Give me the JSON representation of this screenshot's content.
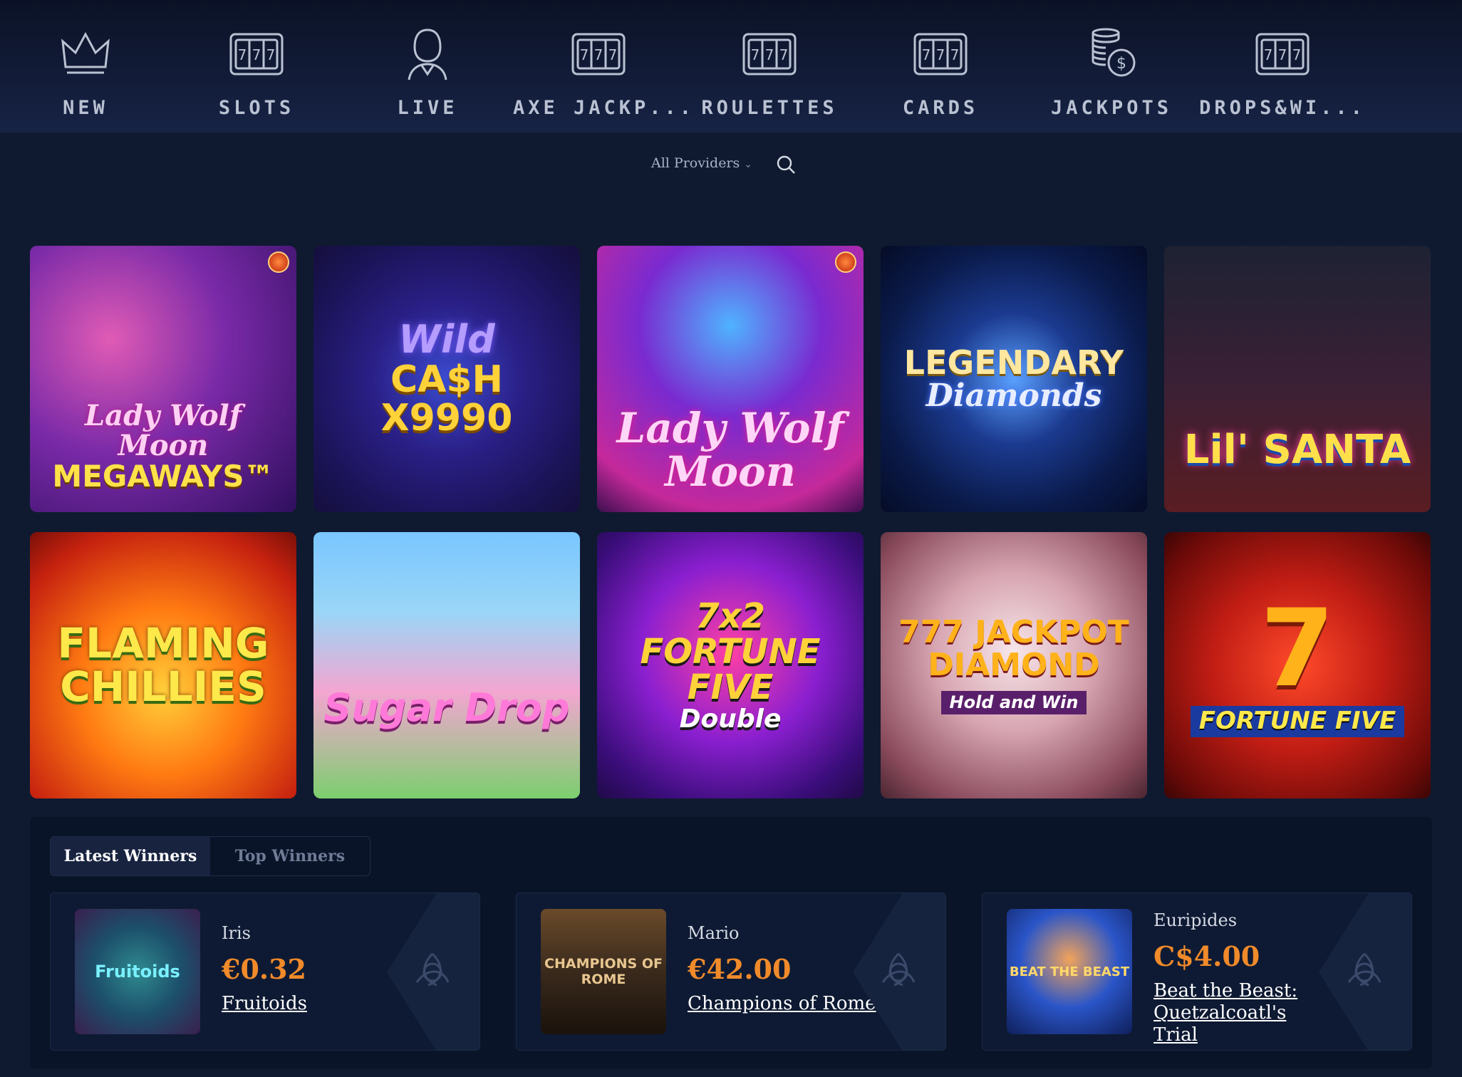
{
  "nav": {
    "items": [
      {
        "label": "NEW",
        "icon": "crown-icon"
      },
      {
        "label": "SLOTS",
        "icon": "slot-machine-icon"
      },
      {
        "label": "LIVE",
        "icon": "live-dealer-icon"
      },
      {
        "label": "AXE JACKP...",
        "icon": "slot-machine-icon"
      },
      {
        "label": "ROULETTES",
        "icon": "slot-machine-icon"
      },
      {
        "label": "CARDS",
        "icon": "slot-machine-icon"
      },
      {
        "label": "JACKPOTS",
        "icon": "coin-stack-icon"
      },
      {
        "label": "DROPS&WI...",
        "icon": "slot-machine-icon"
      }
    ],
    "icon_color": "#b9c1d2"
  },
  "filters": {
    "providers_label": "All Providers"
  },
  "games": [
    {
      "title": "Lady Wolf Moon",
      "subtitle": "MEGAWAYS™",
      "badge": true
    },
    {
      "title": "Wild",
      "subtitle": "CA$H X9990",
      "badge": false
    },
    {
      "title": "Lady Wolf Moon",
      "subtitle": "",
      "badge": true
    },
    {
      "title": "LEGENDARY",
      "subtitle": "Diamonds",
      "badge": false
    },
    {
      "title": "Lil' SANTA",
      "subtitle": "",
      "badge": false
    },
    {
      "title": "FLAMING",
      "subtitle": "CHILLIES",
      "badge": false
    },
    {
      "title": "Sugar Drop",
      "subtitle": "",
      "badge": false
    },
    {
      "title": "7x2 FORTUNE FIVE",
      "subtitle": "Double",
      "badge": false
    },
    {
      "title": "777 JACKPOT DIAMOND",
      "subtitle": "Hold and Win",
      "badge": false
    },
    {
      "title": "7",
      "subtitle": "FORTUNE FIVE",
      "badge": false
    }
  ],
  "winners": {
    "tabs": [
      "Latest Winners",
      "Top Winners"
    ],
    "active_tab": "Latest Winners",
    "entries": [
      {
        "name": "Iris",
        "amount": "€0.32",
        "game": "Fruitoids",
        "thumb_text": "Fruitoids"
      },
      {
        "name": "Mario",
        "amount": "€42.00",
        "game": "Champions of Rome",
        "thumb_text": "CHAMPIONS OF ROME"
      },
      {
        "name": "Euripides",
        "amount": "C$4.00",
        "game": "Beat the Beast: Quetzalcoatl's Trial",
        "thumb_text": "BEAT THE BEAST"
      }
    ],
    "amount_color": "#f08a2a"
  }
}
